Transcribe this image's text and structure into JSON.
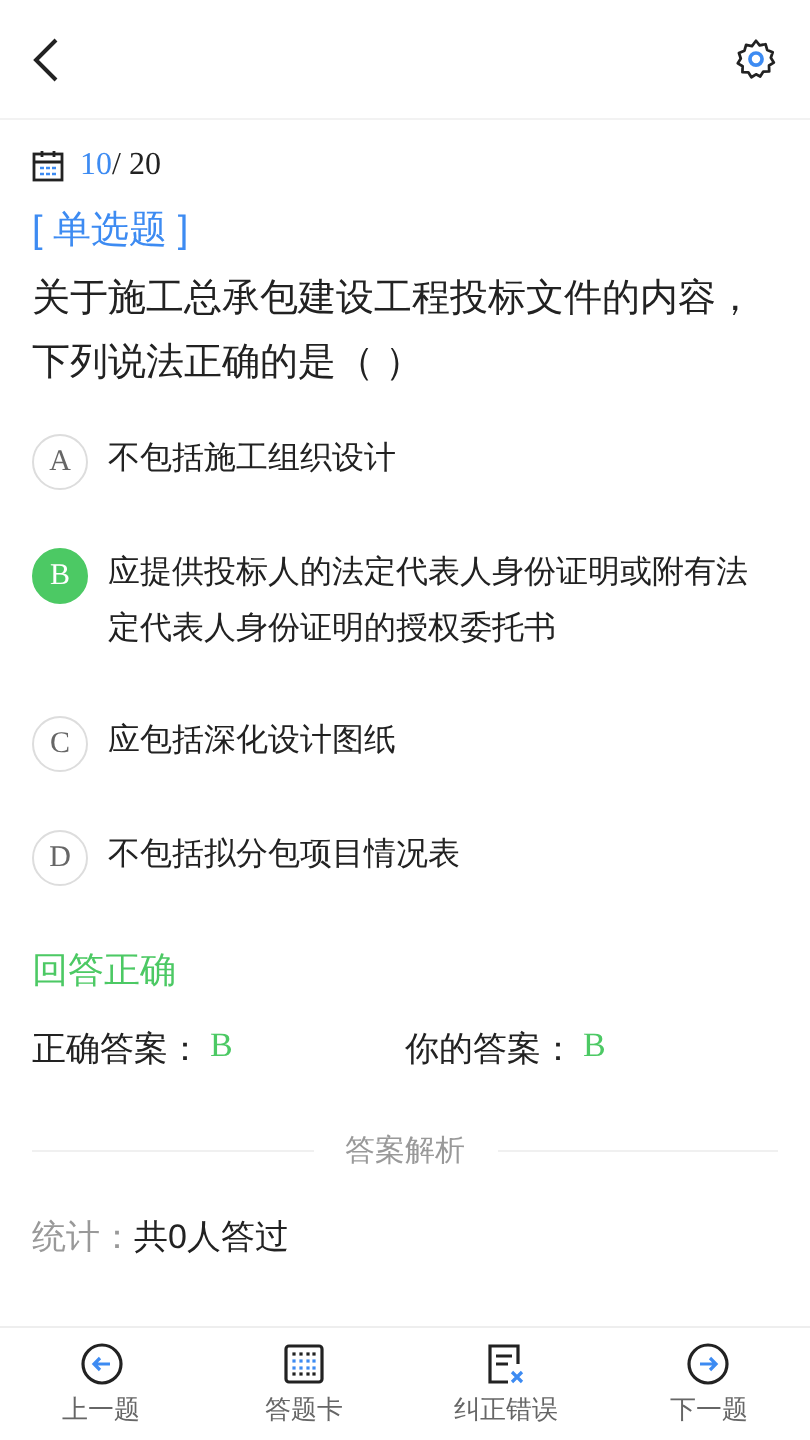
{
  "header": {
    "counter_current": "10",
    "counter_total": "/ 20"
  },
  "question": {
    "type": "[ 单选题 ]",
    "text": "关于施工总承包建设工程投标文件的内容，下列说法正确的是（ ）",
    "options": [
      {
        "letter": "A",
        "text": "不包括施工组织设计",
        "selected": false
      },
      {
        "letter": "B",
        "text": "应提供投标人的法定代表人身份证明或附有法定代表人身份证明的授权委托书",
        "selected": true
      },
      {
        "letter": "C",
        "text": "应包括深化设计图纸",
        "selected": false
      },
      {
        "letter": "D",
        "text": "不包括拟分包项目情况表",
        "selected": false
      }
    ]
  },
  "result": {
    "verdict": "回答正确",
    "correct_label": "正确答案：",
    "correct_value": "B",
    "yours_label": "你的答案：",
    "yours_value": "B"
  },
  "analysis": {
    "title": "答案解析",
    "stats_label": "统计：",
    "stats_value": "共0人答过"
  },
  "bottom_bar": [
    {
      "kind": "prev",
      "label": "上一题"
    },
    {
      "kind": "card",
      "label": "答题卡"
    },
    {
      "kind": "report",
      "label": "纠正错误"
    },
    {
      "kind": "next",
      "label": "下一题"
    }
  ]
}
